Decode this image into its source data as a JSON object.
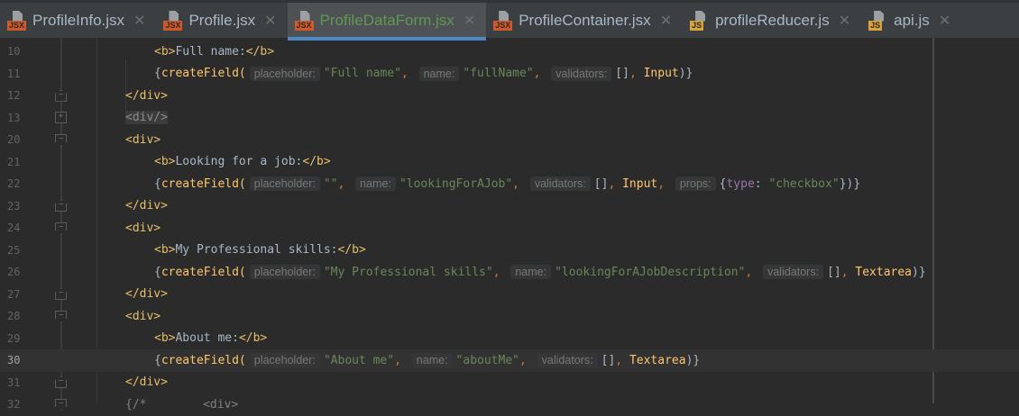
{
  "tabs": [
    {
      "label": "ProfileInfo.jsx",
      "type": "JSX",
      "type_color": "#d0592c",
      "active": false
    },
    {
      "label": "Profile.jsx",
      "type": "JSX",
      "type_color": "#d0592c",
      "active": false
    },
    {
      "label": "ProfileDataForm.jsx",
      "type": "JSX",
      "type_color": "#d0592c",
      "active": true
    },
    {
      "label": "ProfileContainer.jsx",
      "type": "JSX",
      "type_color": "#d0592c",
      "active": false
    },
    {
      "label": "profileReducer.js",
      "type": "JS",
      "type_color": "#d8a33a",
      "active": false
    },
    {
      "label": "api.js",
      "type": "JS",
      "type_color": "#d8a33a",
      "active": false
    }
  ],
  "close_glyph": "✕",
  "lines": [
    {
      "n": "10",
      "indent": 2,
      "fold": "",
      "tokens": [
        [
          "tag",
          "<b>"
        ],
        [
          "txt",
          "Full name:"
        ],
        [
          "tag",
          "</b>"
        ]
      ]
    },
    {
      "n": "11",
      "indent": 2,
      "fold": "",
      "tokens": [
        [
          "txt",
          "{"
        ],
        [
          "fn",
          "createField("
        ],
        [
          "hint",
          "placeholder:"
        ],
        [
          "str",
          "\"Full name\""
        ],
        [
          "kw",
          ", "
        ],
        [
          "hint",
          "name:"
        ],
        [
          "str",
          "\"fullName\""
        ],
        [
          "kw",
          ", "
        ],
        [
          "hint",
          "validators:"
        ],
        [
          "txt",
          "[]"
        ],
        [
          "kw",
          ", "
        ],
        [
          "fn",
          "Input"
        ],
        [
          "txt",
          ")}"
        ]
      ]
    },
    {
      "n": "12",
      "indent": 1,
      "fold": "end",
      "tokens": [
        [
          "tag",
          "</div>"
        ]
      ]
    },
    {
      "n": "13",
      "indent": 1,
      "fold": "plus",
      "tokens": [
        [
          "fp",
          "<div/>"
        ]
      ]
    },
    {
      "n": "20",
      "indent": 1,
      "fold": "start",
      "tokens": [
        [
          "tag",
          "<div>"
        ]
      ]
    },
    {
      "n": "21",
      "indent": 2,
      "fold": "",
      "tokens": [
        [
          "tag",
          "<b>"
        ],
        [
          "txt",
          "Looking for a job:"
        ],
        [
          "tag",
          "</b>"
        ]
      ]
    },
    {
      "n": "22",
      "indent": 2,
      "fold": "",
      "tokens": [
        [
          "txt",
          "{"
        ],
        [
          "fn",
          "createField("
        ],
        [
          "hint",
          "placeholder:"
        ],
        [
          "str",
          "\"\""
        ],
        [
          "kw",
          ", "
        ],
        [
          "hint",
          "name:"
        ],
        [
          "str",
          "\"lookingForAJob\""
        ],
        [
          "kw",
          ", "
        ],
        [
          "hint",
          "validators:"
        ],
        [
          "txt",
          "[]"
        ],
        [
          "kw",
          ", "
        ],
        [
          "fn",
          "Input"
        ],
        [
          "kw",
          ", "
        ],
        [
          "hint",
          "props:"
        ],
        [
          "txt",
          "{"
        ],
        [
          "prop",
          "type"
        ],
        [
          "txt",
          ": "
        ],
        [
          "str",
          "\"checkbox\""
        ],
        [
          "txt",
          "})}"
        ]
      ]
    },
    {
      "n": "23",
      "indent": 1,
      "fold": "end",
      "tokens": [
        [
          "tag",
          "</div>"
        ]
      ]
    },
    {
      "n": "24",
      "indent": 1,
      "fold": "start",
      "tokens": [
        [
          "tag",
          "<div>"
        ]
      ]
    },
    {
      "n": "25",
      "indent": 2,
      "fold": "",
      "tokens": [
        [
          "tag",
          "<b>"
        ],
        [
          "txt",
          "My Professional skills:"
        ],
        [
          "tag",
          "</b>"
        ]
      ]
    },
    {
      "n": "26",
      "indent": 2,
      "fold": "",
      "tokens": [
        [
          "txt",
          "{"
        ],
        [
          "fn",
          "createField("
        ],
        [
          "hint",
          "placeholder:"
        ],
        [
          "str",
          "\"My Professional skills\""
        ],
        [
          "kw",
          ", "
        ],
        [
          "hint",
          "name:"
        ],
        [
          "str",
          "\"lookingForAJobDescription\""
        ],
        [
          "kw",
          ", "
        ],
        [
          "hint",
          "validators:"
        ],
        [
          "txt",
          "[]"
        ],
        [
          "kw",
          ", "
        ],
        [
          "fn",
          "Textarea"
        ],
        [
          "txt",
          ")}"
        ]
      ]
    },
    {
      "n": "27",
      "indent": 1,
      "fold": "end",
      "tokens": [
        [
          "tag",
          "</div>"
        ]
      ]
    },
    {
      "n": "28",
      "indent": 1,
      "fold": "start",
      "tokens": [
        [
          "tag",
          "<div>"
        ]
      ]
    },
    {
      "n": "29",
      "indent": 2,
      "fold": "",
      "tokens": [
        [
          "tag",
          "<b>"
        ],
        [
          "txt",
          "About me:"
        ],
        [
          "tag",
          "</b>"
        ]
      ]
    },
    {
      "n": "30",
      "indent": 2,
      "fold": "",
      "current": true,
      "tokens": [
        [
          "txt",
          "{"
        ],
        [
          "fn",
          "createField("
        ],
        [
          "hint",
          "placeholder:"
        ],
        [
          "str",
          "\"About me\""
        ],
        [
          "kw",
          ", "
        ],
        [
          "hint",
          "name:"
        ],
        [
          "str",
          "\"aboutMe\""
        ],
        [
          "kw",
          ", "
        ],
        [
          "hint",
          "validators:"
        ],
        [
          "txt",
          "[]"
        ],
        [
          "kw",
          ", "
        ],
        [
          "fn",
          "Textarea"
        ],
        [
          "txt",
          ")}"
        ]
      ]
    },
    {
      "n": "31",
      "indent": 1,
      "fold": "end",
      "tokens": [
        [
          "tag",
          "</div>"
        ]
      ]
    },
    {
      "n": "32",
      "indent": 1,
      "fold": "start",
      "tokens": [
        [
          "cmt",
          "{/*        <div>"
        ]
      ]
    }
  ]
}
